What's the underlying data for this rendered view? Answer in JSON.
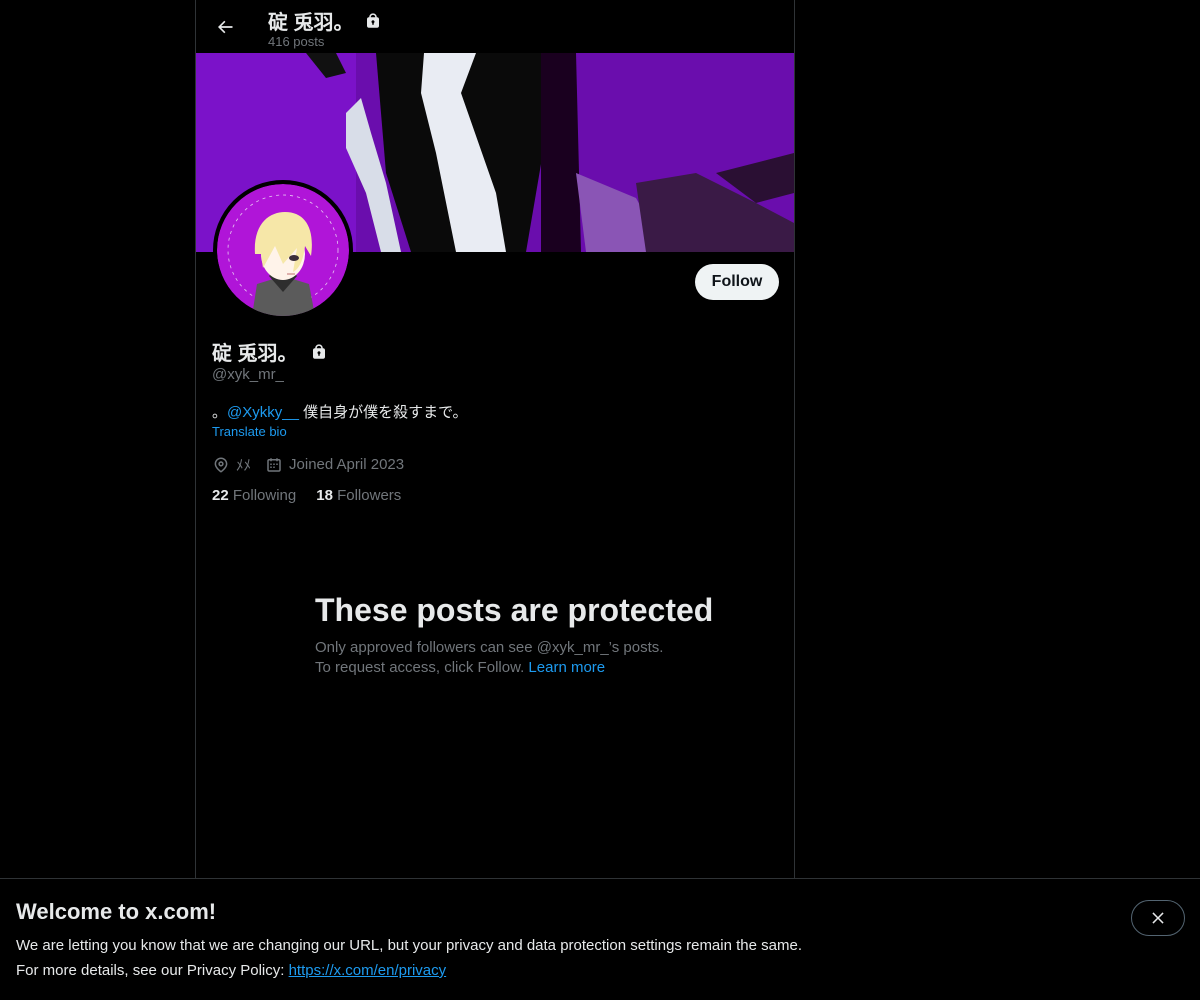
{
  "header": {
    "title": "碇 兎羽。",
    "posts_count": "416 posts"
  },
  "profile": {
    "display_name": "碇 兎羽。",
    "handle": "@xyk_mr_",
    "bio_prefix": "。",
    "bio_mention": "@Xykky__",
    "bio_suffix": " 僕自身が僕を殺すまで。",
    "translate_label": "Translate bio",
    "location": "ﾒﾒ",
    "joined": "Joined April 2023",
    "following_count": "22",
    "following_label": "Following",
    "followers_count": "18",
    "followers_label": "Followers",
    "follow_button": "Follow"
  },
  "protected_notice": {
    "title": "These posts are protected",
    "line1": "Only approved followers can see @xyk_mr_’s posts.",
    "line2": "To request access, click Follow.",
    "learn_more": "Learn more"
  },
  "cookie_banner": {
    "title": "Welcome to x.com!",
    "line1": "We are letting you know that we are changing our URL, but your privacy and data protection settings remain the same.",
    "line2_prefix": "For more details, see our Privacy Policy: ",
    "link": "https://x.com/en/privacy"
  },
  "icons": {
    "back": "arrow-left-icon",
    "lock": "lock-icon",
    "location": "location-pin-icon",
    "calendar": "calendar-icon",
    "close": "close-icon"
  },
  "colors": {
    "accent": "#1d9bf0",
    "banner_purple": "#6a0dad",
    "text_primary": "#e7e9ea",
    "text_secondary": "#71767b"
  }
}
